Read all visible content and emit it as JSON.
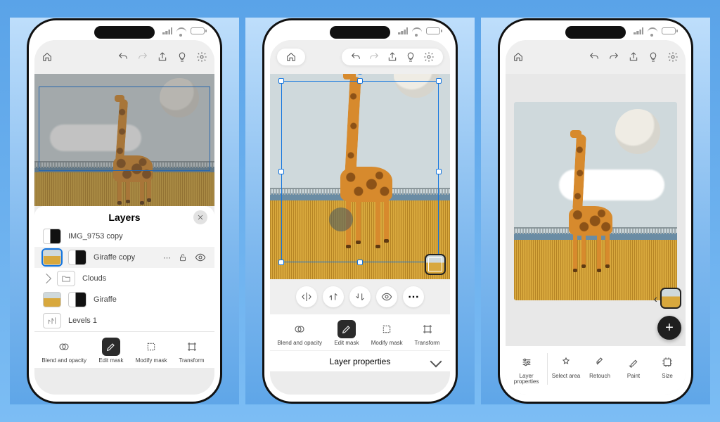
{
  "toolbar": {
    "home": "home-icon",
    "undo": "undo-icon",
    "redo": "redo-icon",
    "share": "share-icon",
    "ideas": "lightbulb-icon",
    "settings": "gear-icon"
  },
  "layers_panel": {
    "title": "Layers",
    "items": [
      {
        "name": "IMG_9753 copy",
        "kind": "image"
      },
      {
        "name": "Giraffe copy",
        "kind": "image-mask",
        "selected": true
      },
      {
        "name": "Clouds",
        "kind": "group",
        "collapsed": true
      },
      {
        "name": "Giraffe",
        "kind": "image"
      },
      {
        "name": "Levels 1",
        "kind": "adjustment"
      }
    ],
    "row_actions": {
      "more": "⋯",
      "lock": "lock-open-icon",
      "visibility": "eye-icon"
    }
  },
  "layer_property_tools": {
    "blend": "Blend and opacity",
    "edit_mask": "Edit mask",
    "modify_mask": "Modify mask",
    "transform": "Transform",
    "bar_label": "Layer properties"
  },
  "pill_tools": {
    "flip_h": "flip-horizontal-icon",
    "order_up": "arrange-up-icon",
    "order_down": "arrange-down-icon",
    "visibility": "eye-icon",
    "more": "⋯"
  },
  "bottom_main": {
    "layer_props": "Layer properties",
    "select_area": "Select area",
    "retouch": "Retouch",
    "paint": "Paint",
    "size": "Size"
  },
  "fab": {
    "label": "+"
  },
  "colors": {
    "selection": "#1275e0"
  }
}
